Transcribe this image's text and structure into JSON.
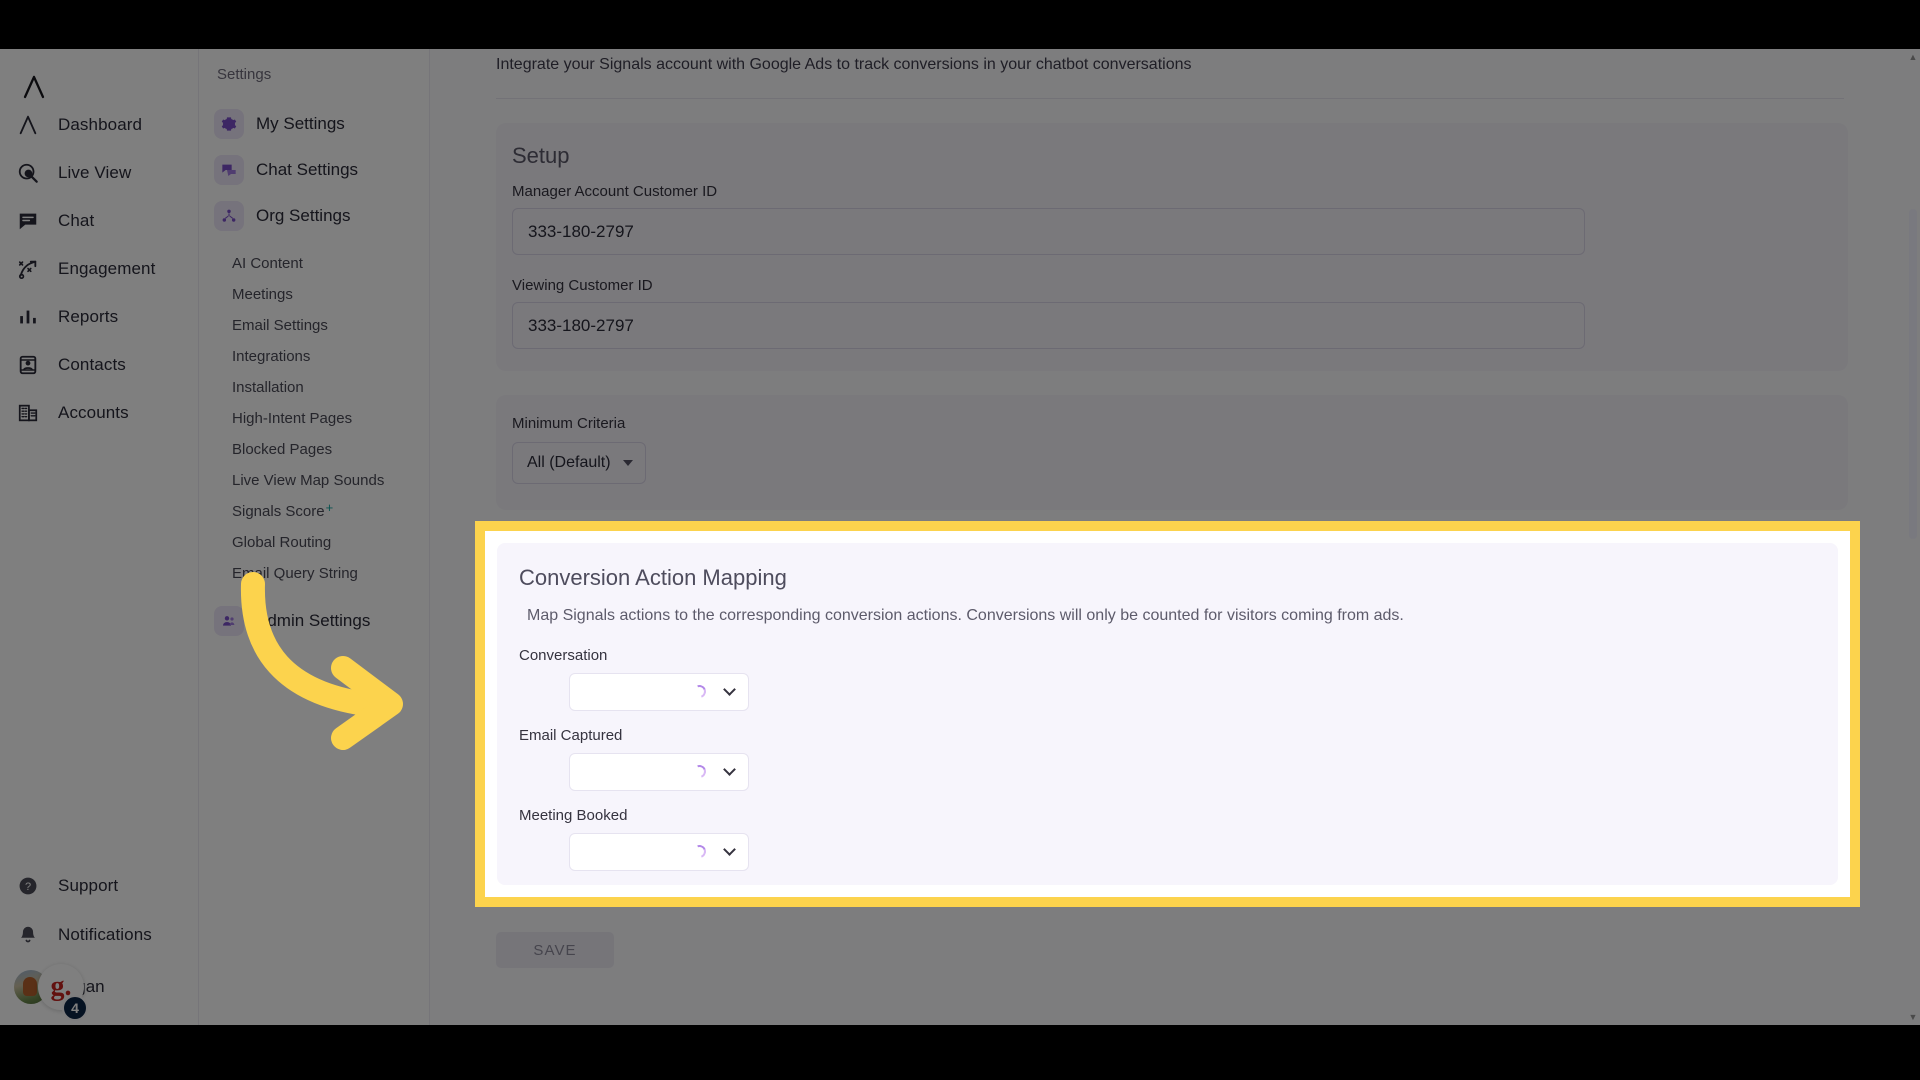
{
  "app": {
    "brand_logo": "lambda-logo",
    "accent_purple": "#7b4fc9",
    "highlight_yellow": "#fcd34d",
    "teal": "#12a5a0"
  },
  "leftnav": {
    "items": [
      {
        "label": "Dashboard",
        "icon": "dashboard-icon"
      },
      {
        "label": "Live View",
        "icon": "live-view-icon"
      },
      {
        "label": "Chat",
        "icon": "chat-icon"
      },
      {
        "label": "Engagement",
        "icon": "engagement-icon"
      },
      {
        "label": "Reports",
        "icon": "reports-icon"
      },
      {
        "label": "Contacts",
        "icon": "contacts-icon"
      },
      {
        "label": "Accounts",
        "icon": "accounts-icon"
      }
    ],
    "bottom": [
      {
        "label": "Support",
        "icon": "help-circle-icon"
      },
      {
        "label": "Notifications",
        "icon": "bell-icon"
      }
    ],
    "user": {
      "name": "Ngan",
      "logo_badge": "g.",
      "count_badge": "4"
    },
    "collapse_icon": "chevron-left-icon"
  },
  "subnav": {
    "title": "Settings",
    "major": [
      {
        "label": "My Settings",
        "icon": "gear-icon"
      },
      {
        "label": "Chat Settings",
        "icon": "chat-bubbles-icon"
      },
      {
        "label": "Org Settings",
        "icon": "org-icon"
      }
    ],
    "minor": [
      {
        "label": "AI Content"
      },
      {
        "label": "Meetings"
      },
      {
        "label": "Email Settings"
      },
      {
        "label": "Integrations"
      },
      {
        "label": "Installation"
      },
      {
        "label": "High-Intent Pages"
      },
      {
        "label": "Blocked Pages"
      },
      {
        "label": "Live View Map Sounds"
      },
      {
        "label": "Signals Score",
        "sup": "+"
      },
      {
        "label": "Global Routing"
      },
      {
        "label": "Email Query String"
      }
    ],
    "admin": {
      "label": "Admin Settings",
      "icon": "admin-icon"
    }
  },
  "main": {
    "intro": "Integrate your Signals account with Google Ads to track conversions in your chatbot conversations",
    "setup": {
      "title": "Setup",
      "fields": [
        {
          "label": "Manager Account Customer ID",
          "value": "333-180-2797",
          "placeholder": ""
        },
        {
          "label": "Viewing Customer ID",
          "value": "333-180-2797",
          "placeholder": ""
        }
      ]
    },
    "criteria": {
      "label": "Minimum Criteria",
      "selected": "All (Default)",
      "options": [
        "All (Default)"
      ]
    },
    "save_label": "SAVE"
  },
  "spotlight": {
    "title": "Conversion Action Mapping",
    "description": "Map Signals actions to the corresponding conversion actions. Conversions will only be counted for visitors coming from ads.",
    "rows": [
      {
        "label": "Conversation",
        "value": "",
        "state": "loading"
      },
      {
        "label": "Email Captured",
        "value": "",
        "state": "loading"
      },
      {
        "label": "Meeting Booked",
        "value": "",
        "state": "loading"
      }
    ]
  },
  "annotation": {
    "arrow_color": "#fcd34d",
    "arrow_name": "callout-arrow"
  },
  "scrollbar": {
    "up_glyph": "▲",
    "down_glyph": "▼"
  }
}
